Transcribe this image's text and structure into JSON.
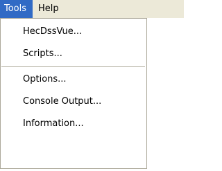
{
  "menubar": {
    "tools_label": "Tools",
    "help_label": "Help"
  },
  "tools_menu": {
    "items": [
      {
        "label": "HecDssVue..."
      },
      {
        "label": "Scripts..."
      },
      {
        "label": "Options..."
      },
      {
        "label": "Console Output..."
      },
      {
        "label": "Information..."
      }
    ]
  },
  "colors": {
    "menubar_background": "#ece9d8",
    "highlight": "#316ac5",
    "highlight_text": "#ffffff",
    "menu_background": "#ffffff",
    "border": "#aca899"
  }
}
